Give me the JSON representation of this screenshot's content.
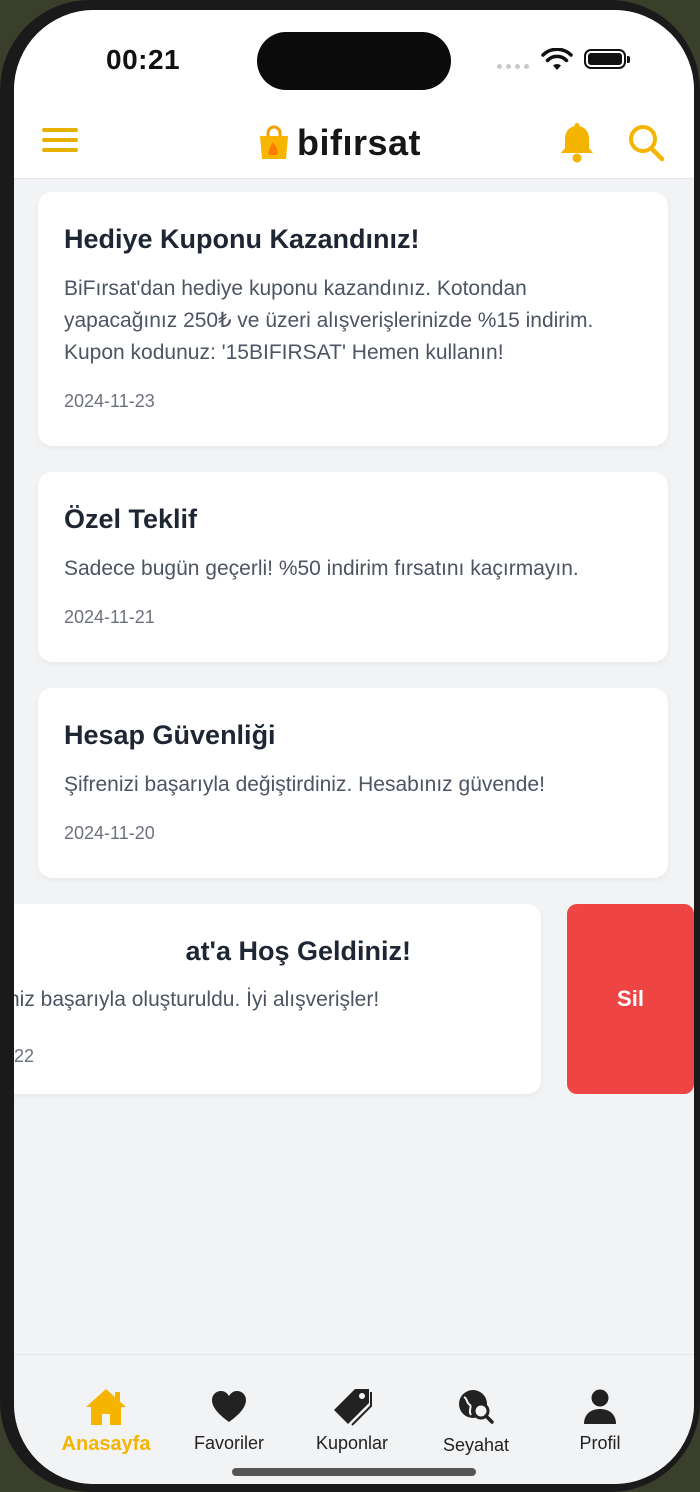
{
  "status_bar": {
    "time": "00:21"
  },
  "header": {
    "logo_text": "bifırsat"
  },
  "notifications": [
    {
      "title": "Hediye Kuponu Kazandınız!",
      "body": "BiFırsat'dan hediye kuponu kazandınız. Kotondan yapacağınız 250₺ ve üzeri alışverişlerinizde %15 indirim. Kupon kodunuz: '15BIFIRSAT' Hemen kullanın!",
      "date": "2024-11-23"
    },
    {
      "title": "Özel Teklif",
      "body": "Sadece bugün geçerli! %50 indirim fırsatını kaçırmayın.",
      "date": "2024-11-21"
    },
    {
      "title": "Hesap Güvenliği",
      "body": "Şifrenizi başarıyla değiştirdiniz. Hesabınız güvende!",
      "date": "2024-11-20"
    },
    {
      "title": "at'a Hoş Geldiniz!",
      "body": "niz başarıyla oluşturuldu. İyi alışverişler!",
      "date": "-22"
    }
  ],
  "swipe_action": {
    "delete_label": "Sil",
    "color": "#ef4444"
  },
  "tabs": [
    {
      "label": "Anasayfa",
      "icon": "home-icon",
      "active": true
    },
    {
      "label": "Favoriler",
      "icon": "heart-icon",
      "active": false
    },
    {
      "label": "Kuponlar",
      "icon": "tag-icon",
      "active": false
    },
    {
      "label": "Seyahat",
      "icon": "globe-search-icon",
      "active": false
    },
    {
      "label": "Profil",
      "icon": "user-icon",
      "active": false
    }
  ],
  "colors": {
    "accent": "#f5b400",
    "danger": "#ef4444",
    "text": "#1e2533"
  }
}
